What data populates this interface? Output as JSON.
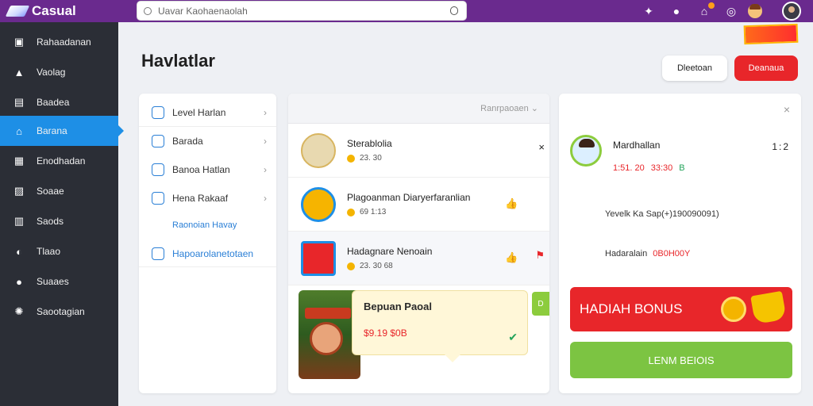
{
  "app": {
    "title": "Casual"
  },
  "search": {
    "placeholder": "Uavar Kaohaenaolah"
  },
  "sidebar": {
    "items": [
      {
        "label": "Rahaadanan",
        "icon": "gamepad-icon"
      },
      {
        "label": "Vaolag",
        "icon": "bag-icon"
      },
      {
        "label": "Baadea",
        "icon": "chart-icon"
      },
      {
        "label": "Barana",
        "icon": "home-icon",
        "active": true
      },
      {
        "label": "Enodhadan",
        "icon": "calendar-icon"
      },
      {
        "label": "Soaae",
        "icon": "image-icon"
      },
      {
        "label": "Saods",
        "icon": "doc-icon"
      },
      {
        "label": "Tlaao",
        "icon": "chat-icon"
      },
      {
        "label": "Suaaes",
        "icon": "user-icon"
      },
      {
        "label": "Saootagian",
        "icon": "settings-icon"
      }
    ]
  },
  "header": {
    "title": "Havlatlar",
    "secondary_button": "Dleetoan",
    "primary_button": "Deanaua"
  },
  "left_panel": {
    "items": [
      {
        "label": "Level Harlan",
        "icon": "lock-icon"
      },
      {
        "label": "Barada",
        "icon": "home-icon"
      },
      {
        "label": "Banoa Hatlan",
        "icon": "shield-icon"
      },
      {
        "label": "Hena Rakaaf",
        "icon": "person-icon"
      }
    ],
    "sublink": "Raonoian Havay",
    "link": "Hapoarolanetotaen"
  },
  "middle_panel": {
    "select_label": "Ranrpaoaen",
    "rows": [
      {
        "name": "Sterablolia",
        "meta": "23. 30",
        "action": "x-icon"
      },
      {
        "name": "Plagoanman Diaryerfaranlian",
        "meta": "69 1:13",
        "action": "thumbs-up-icon"
      },
      {
        "name": "Hadagnare Nenoain",
        "meta": "23. 30 68",
        "action": "thumbs-up-icon"
      }
    ],
    "tooltip": {
      "title": "Bepuan Paoal",
      "price": "$9.19 $0B"
    },
    "side_tab": "D"
  },
  "right_panel": {
    "name": "Mardhallan",
    "score": "1:51. 20",
    "score_extra": "33:30",
    "score_green": "B",
    "menu": "1:2",
    "line1": "Yevelk Ka Sap(+)190090091)",
    "line2_label": "Hadaralain",
    "line2_value": "0B0H00Y",
    "bonus_label": "HADIAH BONUS",
    "cta_label": "LENM BEIOIS"
  },
  "colors": {
    "topbar": "#6a2a8e",
    "sidebar": "#2b2e36",
    "accent_blue": "#1e8fe6",
    "red": "#e8262a",
    "green": "#7cc442"
  }
}
